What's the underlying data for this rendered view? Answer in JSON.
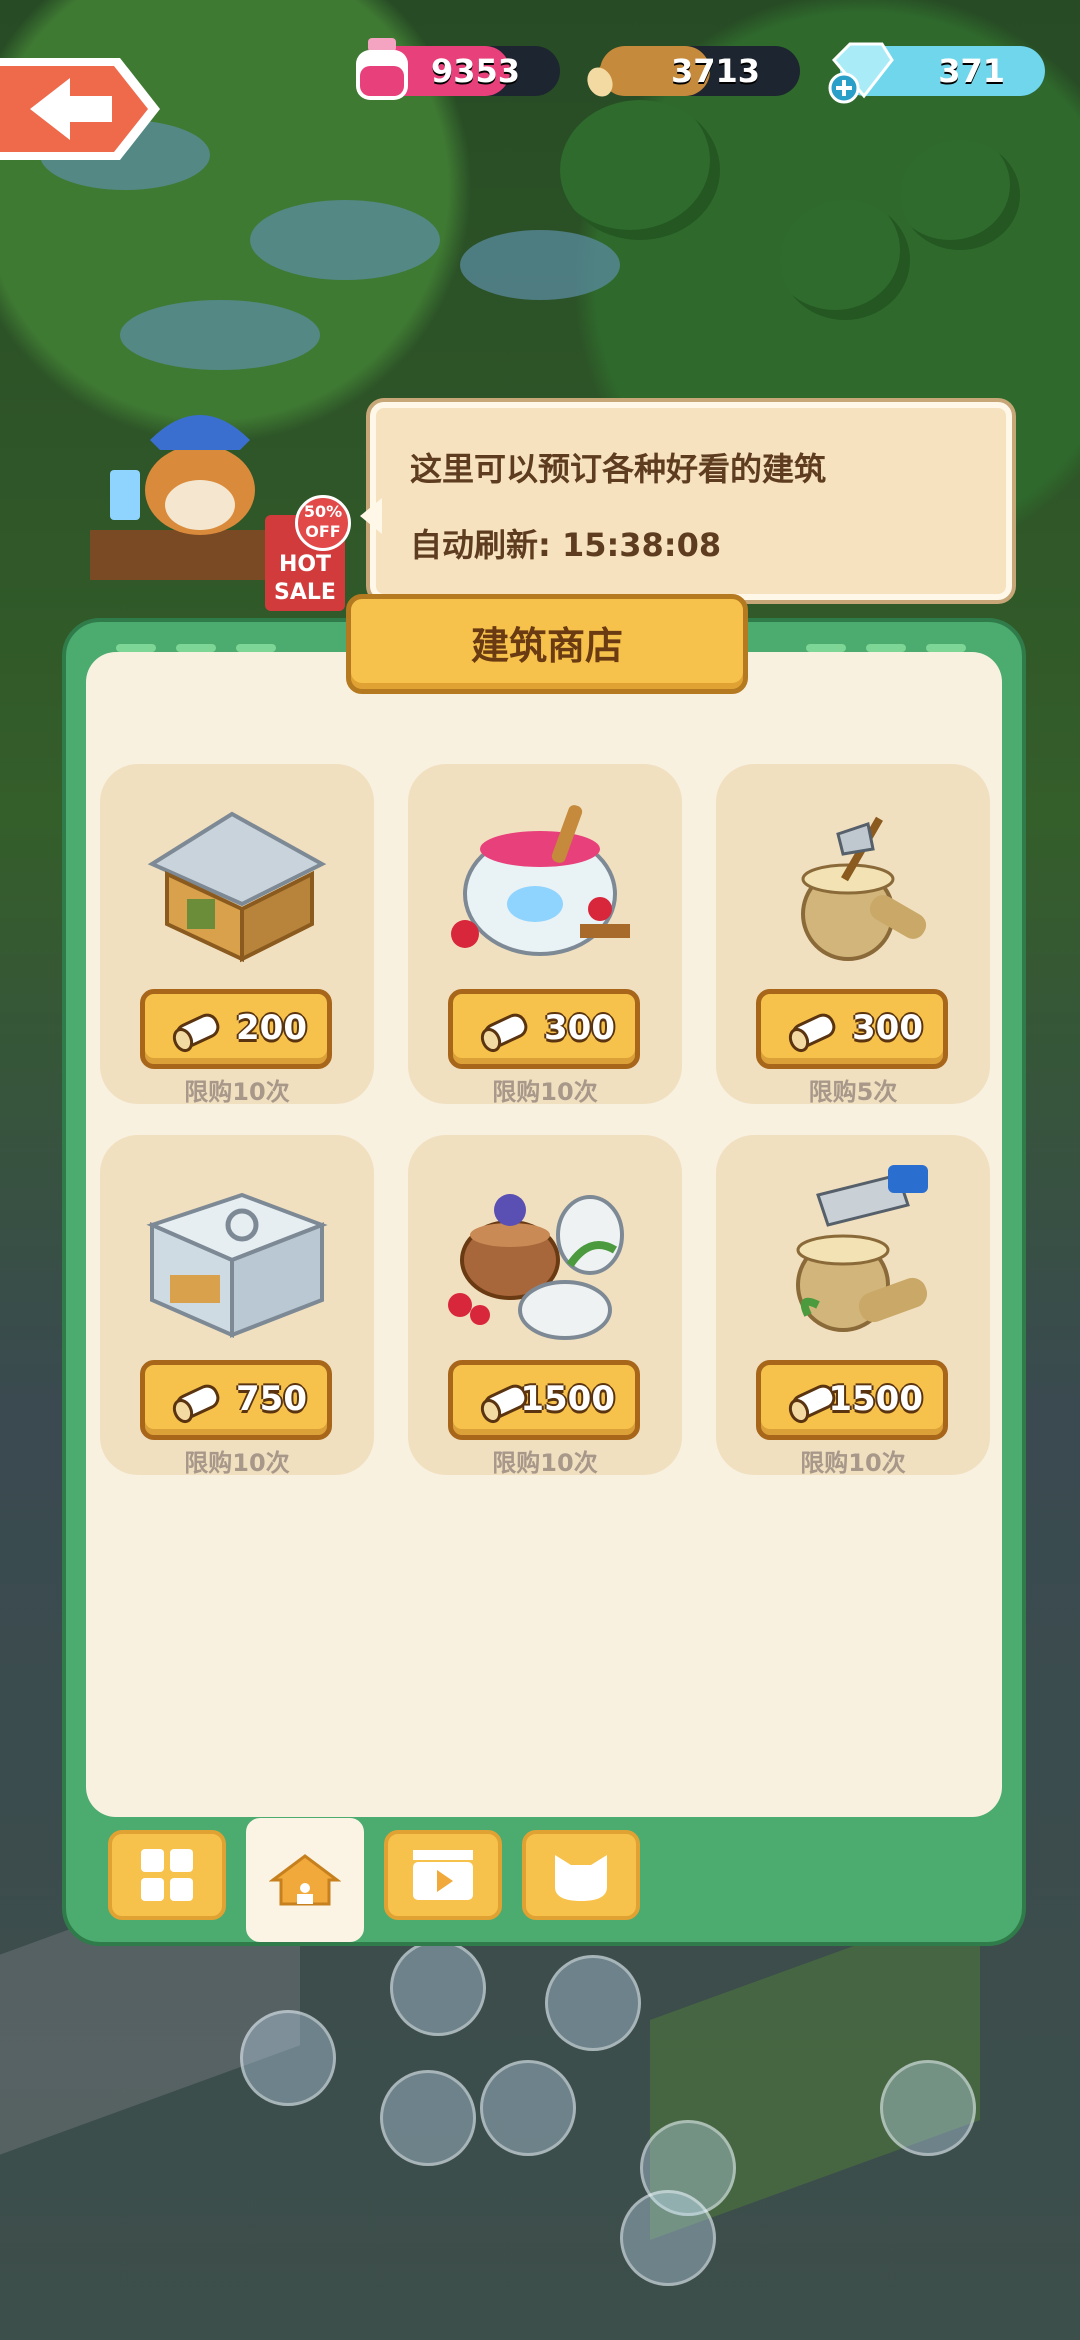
{
  "hud": {
    "ink": "9353",
    "wood": "3713",
    "gems": "371"
  },
  "npc": {
    "sign_pct": "50% OFF",
    "sign_text": "HOT SALE"
  },
  "speech": {
    "line1": "这里可以预订各种好看的建筑",
    "line2": "自动刷新: 15:38:08"
  },
  "shop": {
    "title": "建筑商店",
    "items": [
      {
        "art": "wooden-hut",
        "price": "200",
        "limit": "限购10次"
      },
      {
        "art": "paint-pot",
        "price": "300",
        "limit": "限购10次"
      },
      {
        "art": "axe-stump",
        "price": "300",
        "limit": "限购5次"
      },
      {
        "art": "workshop-box",
        "price": "750",
        "limit": "限购10次"
      },
      {
        "art": "berry-pots",
        "price": "1500",
        "limit": "限购10次"
      },
      {
        "art": "saw-stump",
        "price": "1500",
        "limit": "限购10次"
      }
    ]
  },
  "tabs": [
    {
      "icon": "grid-icon"
    },
    {
      "icon": "house-icon",
      "active": true
    },
    {
      "icon": "video-icon"
    },
    {
      "icon": "cat-icon"
    }
  ],
  "colors": {
    "panel_green": "#4cab6e",
    "button_gold": "#f6c24b",
    "ink_pink": "#e8407a",
    "gem_blue": "#6fd6ec"
  }
}
